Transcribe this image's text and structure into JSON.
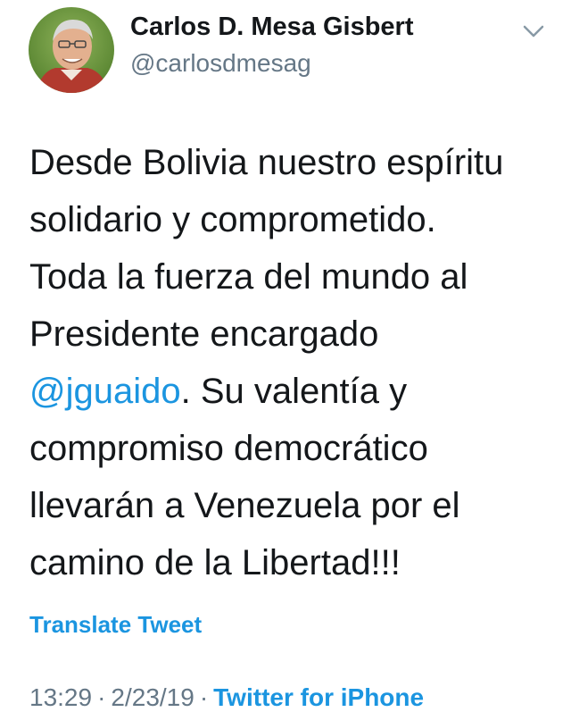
{
  "user": {
    "display_name": "Carlos D. Mesa Gisbert",
    "handle": "@carlosdmesag"
  },
  "tweet": {
    "lines": [
      "Desde Bolivia nuestro espíritu",
      "solidario y comprometido.",
      "Toda la fuerza del mundo al",
      "Presidente encargado"
    ],
    "mention": "@jguaido",
    "mention_line_rest": ". Su valentía y",
    "lines_after": [
      "compromiso democrático",
      "llevarán a Venezuela por el",
      "camino de la Libertad!!!"
    ],
    "translate_label": "Translate Tweet"
  },
  "meta": {
    "time": "13:29",
    "separator": "·",
    "date": "2/23/19",
    "source": "Twitter for iPhone"
  },
  "icons": {
    "menu": "chevron-down-icon"
  },
  "colors": {
    "link": "#1b95e0",
    "secondary_text": "#657786",
    "primary_text": "#14171a"
  }
}
